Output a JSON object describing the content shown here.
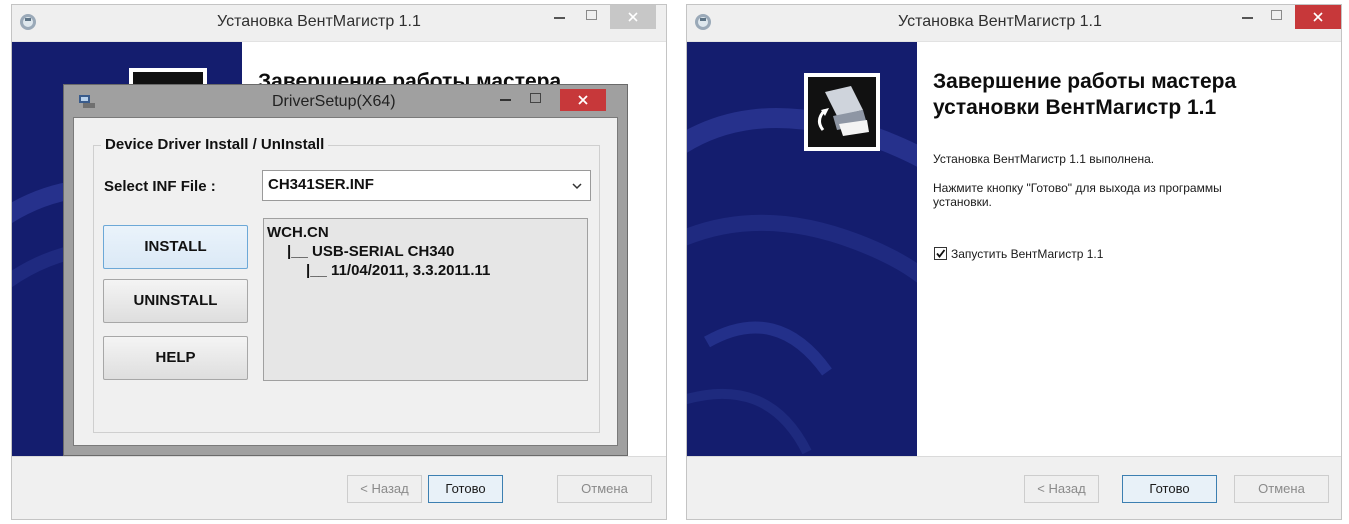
{
  "left_window": {
    "title": "Установка ВентМагистр 1.1",
    "heading_partial": "Завершение работы мастера",
    "buttons": {
      "back": "< Назад",
      "finish": "Готово",
      "cancel": "Отмена"
    }
  },
  "driver_dialog": {
    "title": "DriverSetup(X64)",
    "group_label": "Device Driver Install / UnInstall",
    "select_label": "Select INF File :",
    "select_value": "CH341SER.INF",
    "buttons": {
      "install": "INSTALL",
      "uninstall": "UNINSTALL",
      "help": "HELP"
    },
    "tree": {
      "root": "WCH.CN",
      "child": "|__ USB-SERIAL CH340",
      "grandchild": "|__ 11/04/2011, 3.3.2011.11"
    }
  },
  "right_window": {
    "title": "Установка ВентМагистр 1.1",
    "heading_line1": "Завершение работы мастера",
    "heading_line2": "установки ВентМагистр 1.1",
    "completed_text": "Установка ВентМагистр 1.1 выполнена.",
    "instruction_line1": "Нажмите кнопку \"Готово\" для выхода из программы",
    "instruction_line2": "установки.",
    "launch_checkbox": {
      "label": "Запустить ВентМагистр 1.1",
      "checked": true
    },
    "buttons": {
      "back": "< Назад",
      "finish": "Готово",
      "cancel": "Отмена"
    }
  },
  "colors": {
    "banner": "#141d6e",
    "close_active": "#c7383a",
    "close_inactive": "#c7c7c7"
  },
  "icons": [
    "installer-app-icon",
    "computer-install-icon",
    "driver-setup-app-icon",
    "minimize-icon",
    "maximize-icon",
    "close-icon",
    "dropdown-chevron-icon",
    "checkmark-icon"
  ]
}
